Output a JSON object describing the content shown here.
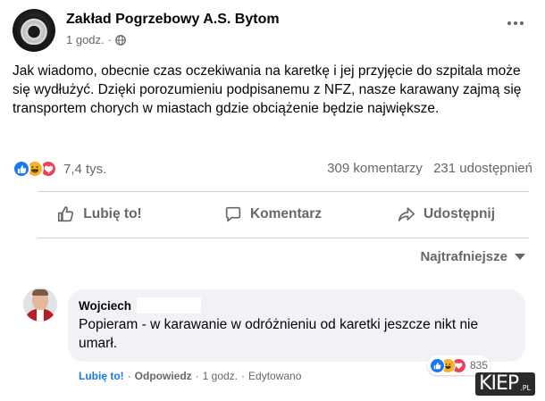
{
  "post": {
    "page_name": "Zakład Pogrzebowy A.S. Bytom",
    "time": "1 godz.",
    "separator": "·",
    "privacy_icon": "globe-icon",
    "more_icon": "ellipsis-icon",
    "text": "Jak wiadomo, obecnie czas oczekiwania na karetkę i jej przyjęcie do szpitala może się wydłużyć. Dzięki porozumieniu podpisanemu z NFZ, nasze karawany zajmą się transportem chorych w miastach gdzie obciążenie będzie największe."
  },
  "stats": {
    "reaction_icons": [
      "like-icon",
      "haha-icon",
      "love-icon"
    ],
    "reaction_count": "7,4 tys.",
    "comments": "309 komentarzy",
    "shares": "231 udostępnień"
  },
  "actions": {
    "like": "Lubię to!",
    "comment": "Komentarz",
    "share": "Udostępnij"
  },
  "sort": {
    "label": "Najtrafniejsze"
  },
  "comment": {
    "author": "Wojciech",
    "text": "Popieram - w karawanie w odróżnieniu od karetki jeszcze nikt nie umarł.",
    "like": "Lubię to!",
    "reply": "Odpowiedz",
    "time": "1 godz.",
    "edited": "Edytowano",
    "separator": "·",
    "reaction_count": "835"
  },
  "watermark": {
    "brand": "KIEP",
    "suffix": ".PL"
  },
  "colors": {
    "accent": "#1877f2",
    "secondary_text": "#65676b",
    "bubble": "#f0f2f5",
    "like": "#1877f2",
    "haha": "#f7b125",
    "love": "#f33e58"
  }
}
